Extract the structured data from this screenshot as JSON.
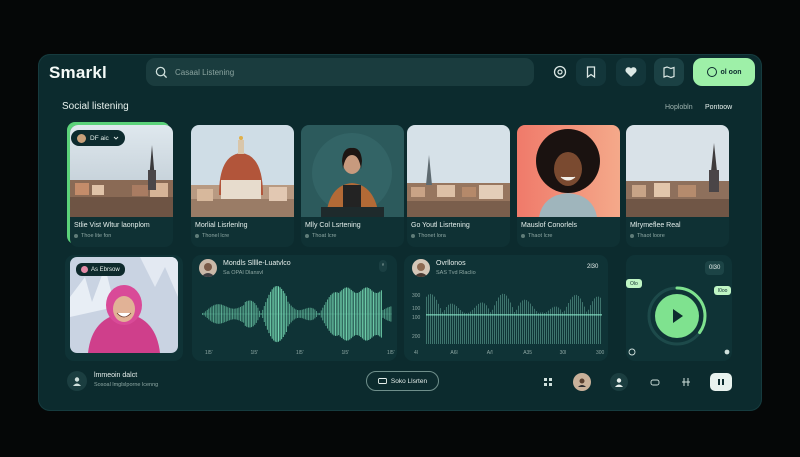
{
  "header": {
    "brand": "Smarkl",
    "search_placeholder": "Casaal Listening",
    "icons": [
      "coin-icon",
      "bookmark-icon",
      "heart-icon",
      "map-icon"
    ],
    "cta_label": "ol oon"
  },
  "section": {
    "title": "Social listening",
    "segments": [
      "Hoplobln",
      "Pontoow"
    ]
  },
  "cards": [
    {
      "title": "Stlie Vist Wltur laonplom",
      "sub": "Thoe lite fon",
      "badge": "DF aic"
    },
    {
      "title": "Morlial Lisrlenlng",
      "sub": "Thonel lcre"
    },
    {
      "title": "Mlly Col Lsrtening",
      "sub": "Thoat lcre"
    },
    {
      "title": "Go Youtl Lisrtening",
      "sub": "Thonet lora"
    },
    {
      "title": "Mauslof Conorlels",
      "sub": "Thaot lcre"
    },
    {
      "title": "Mlrymeflee Real",
      "sub": "Thaot loore"
    }
  ],
  "live": {
    "badge": "As Ebrsow"
  },
  "wave_panel": {
    "title": "Mondls Slllle-Luatvlco",
    "sub": "Sa OPAl Dlansvl",
    "tag": "ᵒ",
    "x_ticks": [
      "1l5'",
      "1l5'",
      "1l5'",
      "1l5'",
      "1l5'"
    ],
    "colors": {
      "wave": "#7ae0b8"
    }
  },
  "signal_panel": {
    "title": "Ovrllonos",
    "sub": "SAS Tvd Rlaclio",
    "value": "2l30",
    "y_ticks": [
      "300",
      "100",
      "100",
      "200"
    ],
    "x_ticks": [
      "4l",
      "A6l",
      "A/l",
      "A35",
      "30l",
      "300"
    ]
  },
  "player": {
    "badge": "0l30",
    "tag_left": "Olo",
    "tag_right": "l0oo",
    "progress": 0.35,
    "colors": {
      "accent": "#7fe28f"
    }
  },
  "bottom_bar": {
    "user_name": "lmmeoin dalct",
    "user_sub": "Sosoal lmglslporne lcenng",
    "center_button": "Soko Llsrten",
    "icons": [
      "grid-icon",
      "avatar-icon",
      "person-icon",
      "cloud-icon",
      "sliders-icon",
      "switch-icon"
    ]
  }
}
